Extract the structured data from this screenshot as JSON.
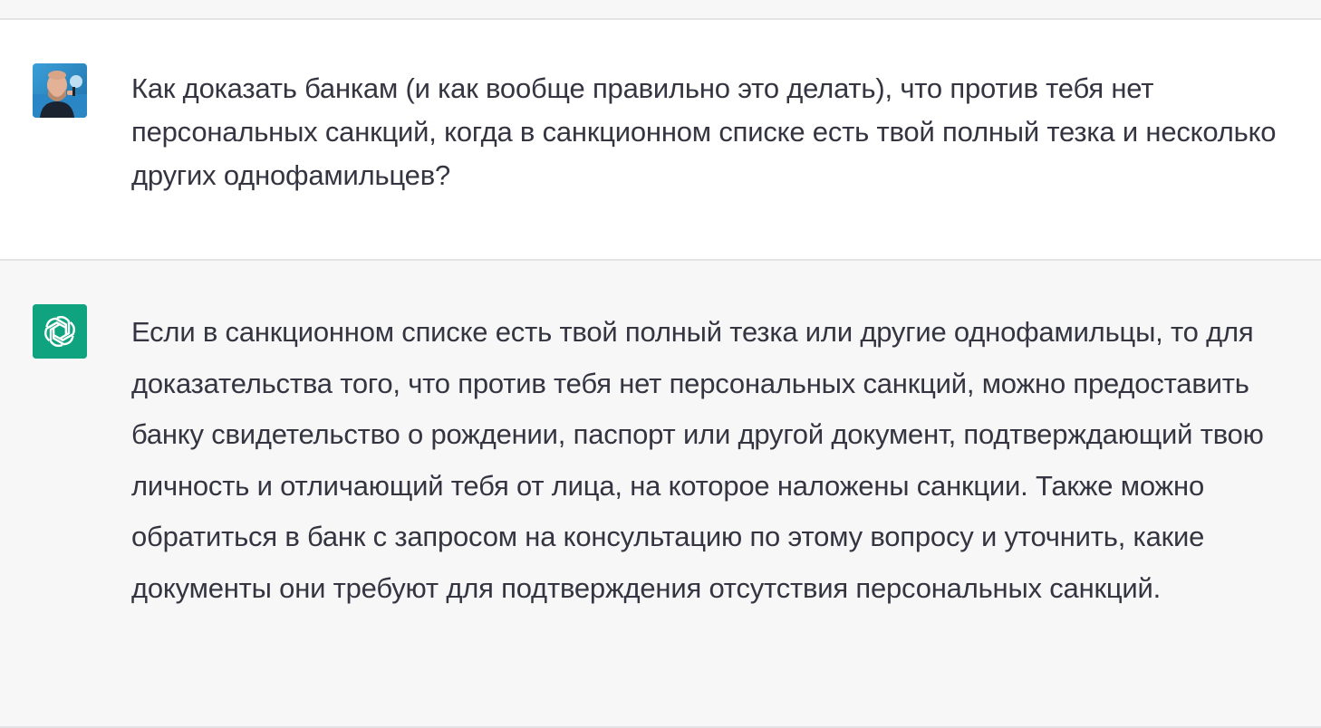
{
  "conversation": {
    "user_message": {
      "text": "Как доказать банкам (и как вообще правильно это делать), что против тебя нет персональных санкций, когда в санкционном списке есть твой полный тезка и несколько других однофамильцев?",
      "avatar_icon": "user-photo-avatar"
    },
    "assistant_message": {
      "text": "Если в санкционном списке есть твой полный тезка или другие однофамильцы, то для доказательства того, что против тебя нет персональных санкций, можно предоставить банку свидетельство о рождении, паспорт или другой документ, подтверждающий твою личность и отличающий тебя от лица, на которое наложены санкции. Также можно обратиться в банк с запросом на консультацию по этому вопросу и уточнить, какие документы они требуют для подтверждения отсутствия персональных санкций.",
      "avatar_icon": "openai-logo-icon",
      "avatar_color": "#10a37f"
    }
  },
  "colors": {
    "user_bg": "#ffffff",
    "assistant_bg": "#f7f7f8",
    "text": "#343541",
    "divider": "#e3e3e6"
  }
}
